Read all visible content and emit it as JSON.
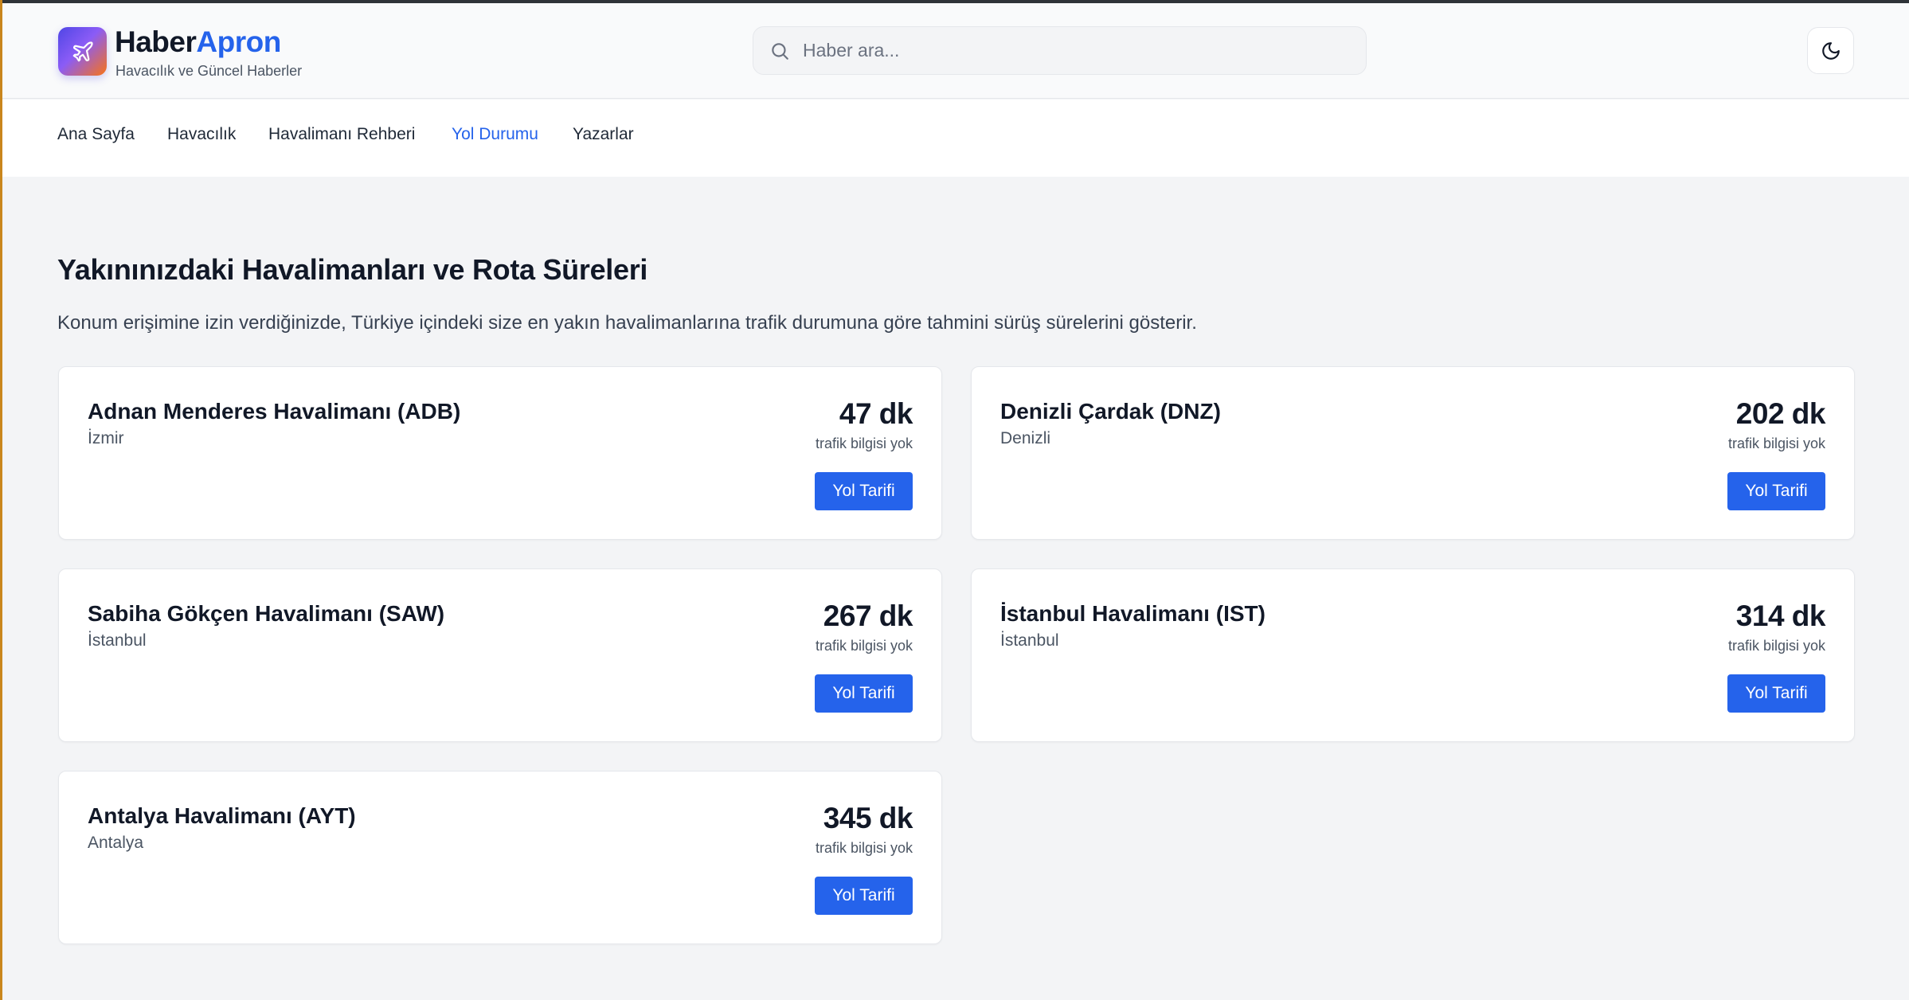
{
  "brand": {
    "name_part1": "Haber",
    "name_part2": "Apron",
    "tagline": "Havacılık ve Güncel Haberler",
    "logo_icon": "airplane-icon",
    "accent_color": "#2563eb"
  },
  "search": {
    "placeholder": "Haber ara...",
    "value": "",
    "icon": "search-icon"
  },
  "theme_toggle": {
    "icon": "moon-icon"
  },
  "nav": {
    "items": [
      {
        "label": "Ana Sayfa",
        "active": false
      },
      {
        "label": "Havacılık",
        "active": false
      },
      {
        "label": "Havalimanı Rehberi",
        "active": false
      },
      {
        "label": "Yol Durumu",
        "active": true
      },
      {
        "label": "Yazarlar",
        "active": false
      }
    ]
  },
  "main": {
    "title": "Yakınınızdaki Havalimanları ve Rota Süreleri",
    "description": "Konum erişimine izin verdiğinizde, Türkiye içindeki size en yakın havalimanlarına trafik durumuna göre tahmini sürüş sürelerini gösterir.",
    "airports": [
      {
        "name": "Adnan Menderes Havalimanı (ADB)",
        "city": "İzmir",
        "duration": "47 dk",
        "traffic": "trafik bilgisi yok",
        "button": "Yol Tarifi"
      },
      {
        "name": "Denizli Çardak (DNZ)",
        "city": "Denizli",
        "duration": "202 dk",
        "traffic": "trafik bilgisi yok",
        "button": "Yol Tarifi"
      },
      {
        "name": "Sabiha Gökçen Havalimanı (SAW)",
        "city": "İstanbul",
        "duration": "267 dk",
        "traffic": "trafik bilgisi yok",
        "button": "Yol Tarifi"
      },
      {
        "name": "İstanbul Havalimanı (IST)",
        "city": "İstanbul",
        "duration": "314 dk",
        "traffic": "trafik bilgisi yok",
        "button": "Yol Tarifi"
      },
      {
        "name": "Antalya Havalimanı (AYT)",
        "city": "Antalya",
        "duration": "345 dk",
        "traffic": "trafik bilgisi yok",
        "button": "Yol Tarifi"
      }
    ]
  }
}
